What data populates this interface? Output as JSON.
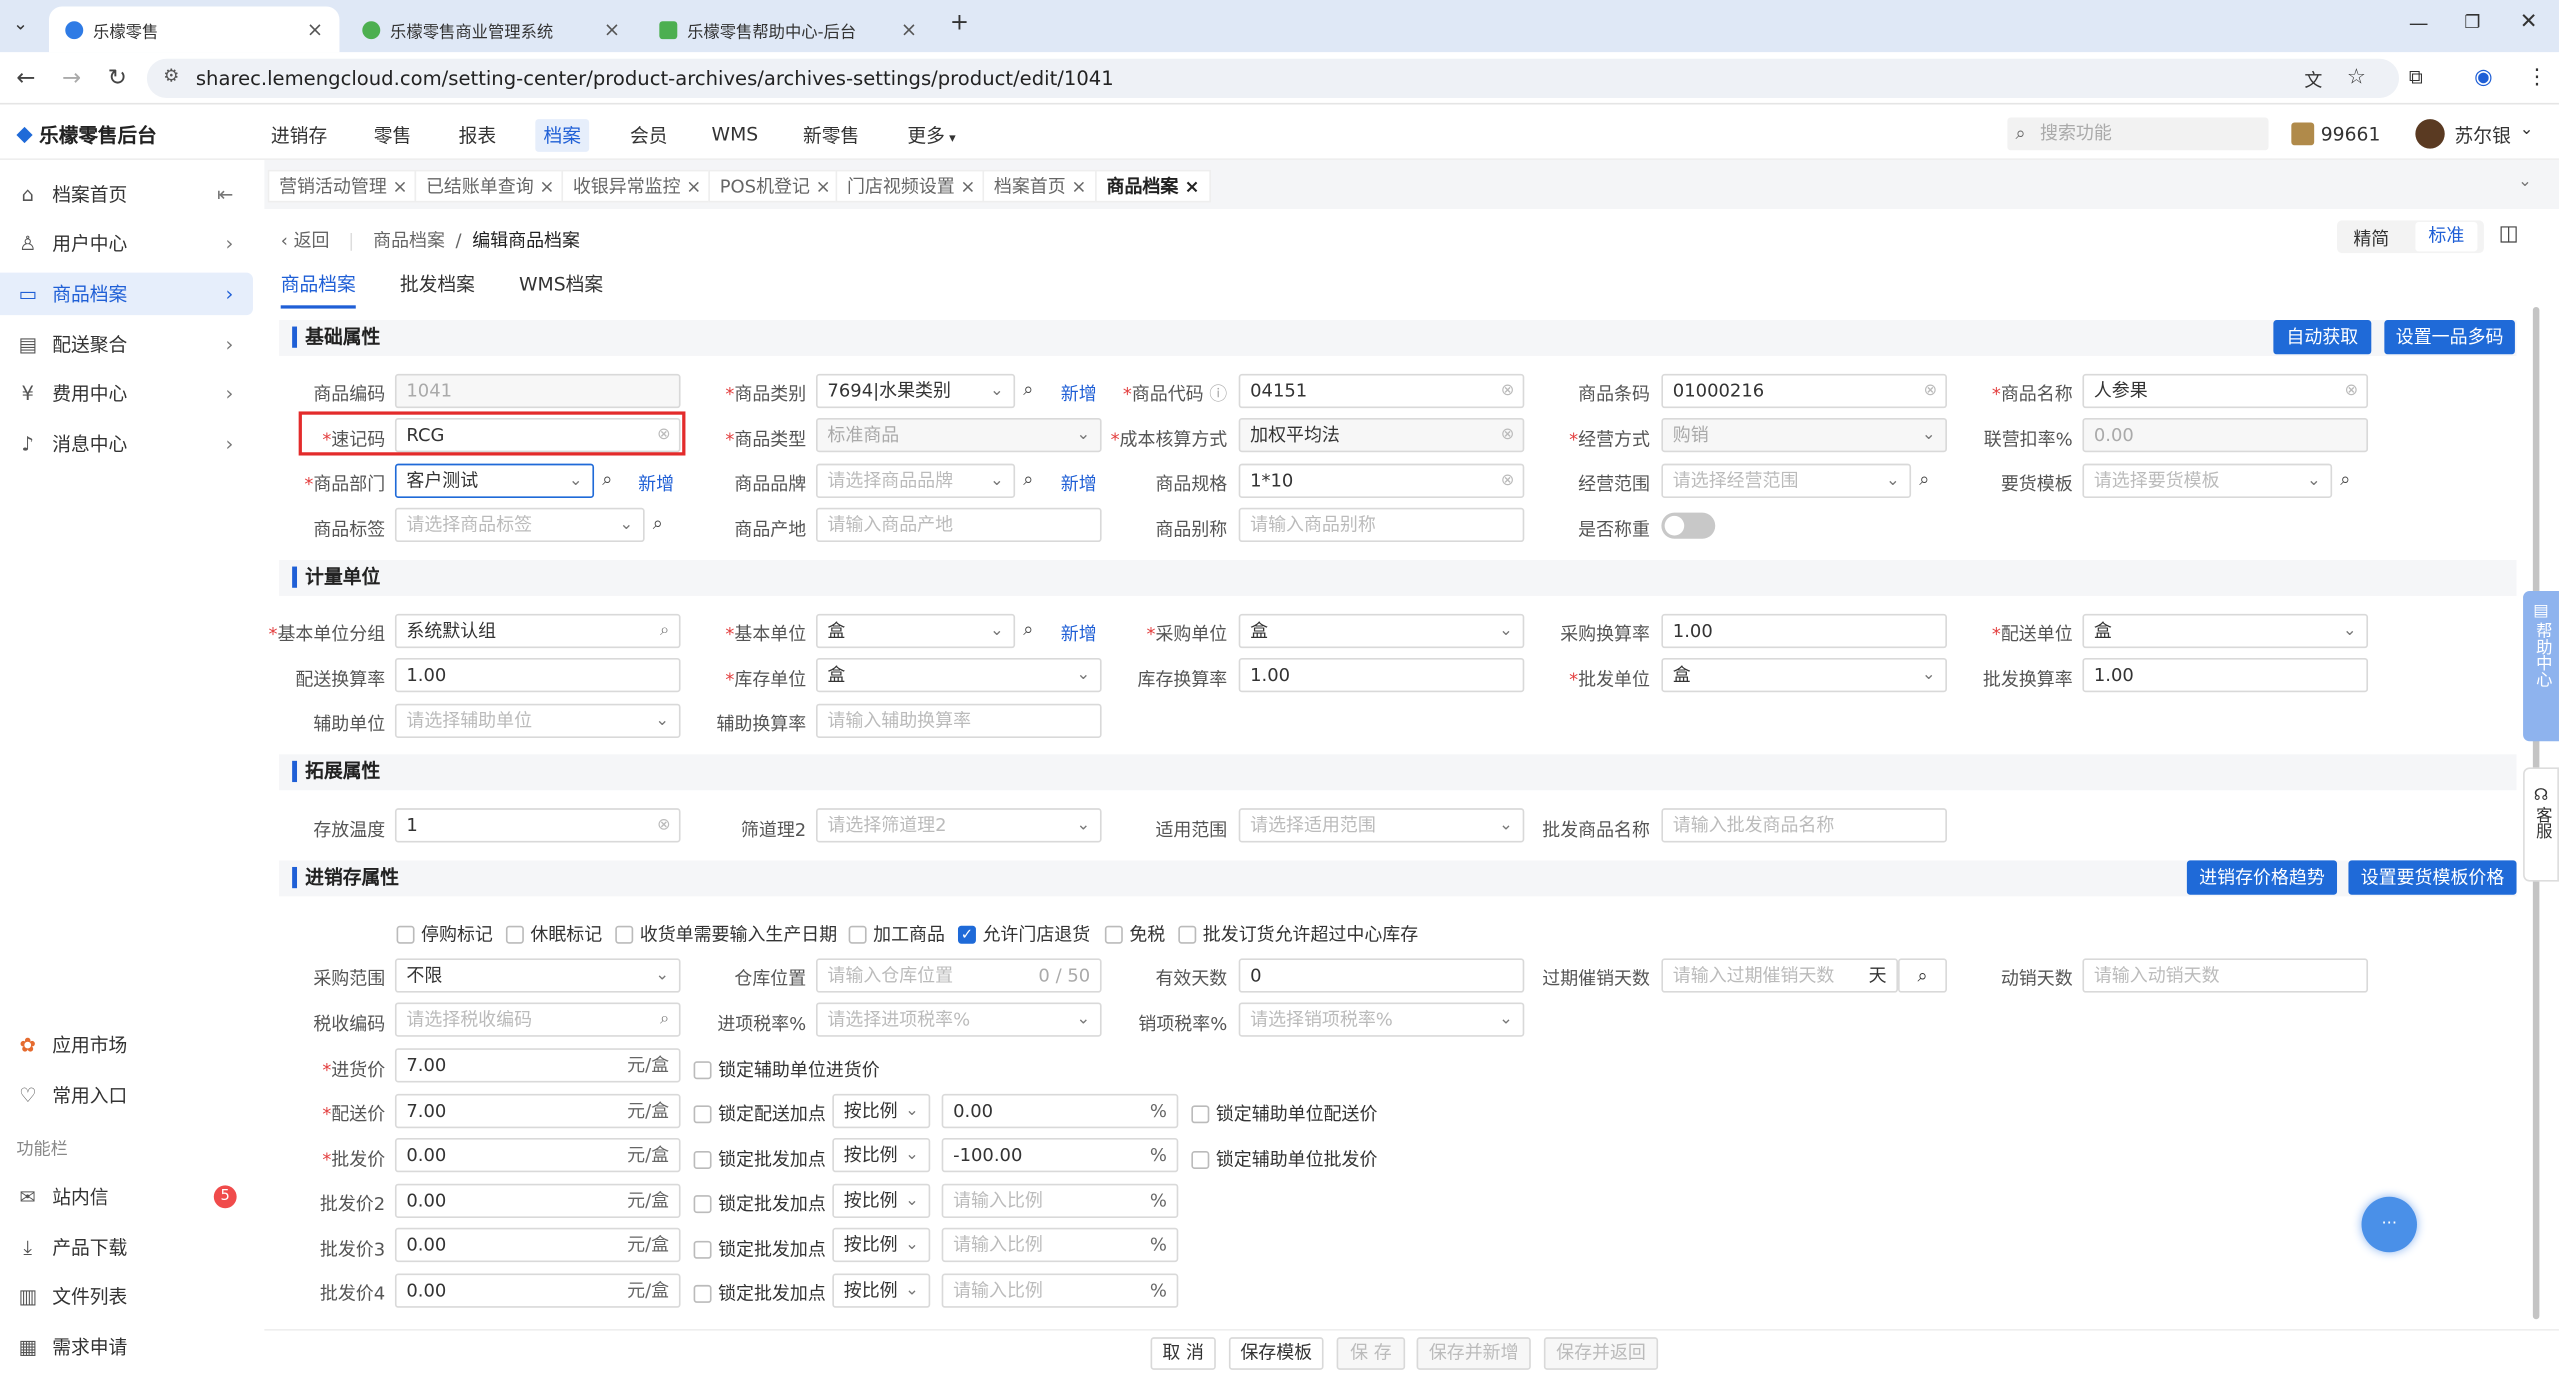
{
  "browser": {
    "tabs": [
      {
        "title": "乐檬零售",
        "active": true
      },
      {
        "title": "乐檬零售商业管理系统",
        "active": false
      },
      {
        "title": "乐檬零售帮助中心-后台",
        "active": false
      }
    ],
    "url": "sharec.lemengcloud.com/setting-center/product-archives/archives-settings/product/edit/1041"
  },
  "app": {
    "logo": "乐檬零售后台",
    "nav": [
      "进销存",
      "零售",
      "报表",
      "档案",
      "会员",
      "WMS",
      "新零售",
      "更多"
    ],
    "active_nav": "档案",
    "search_placeholder": "搜索功能",
    "points": "99661",
    "user": "苏尔银"
  },
  "sidebar": {
    "items": [
      {
        "label": "档案首页",
        "icon": "home-icon"
      },
      {
        "label": "用户中心",
        "icon": "user-icon"
      },
      {
        "label": "商品档案",
        "icon": "box-icon"
      },
      {
        "label": "配送聚合",
        "icon": "truck-icon"
      },
      {
        "label": "费用中心",
        "icon": "yen-icon"
      },
      {
        "label": "消息中心",
        "icon": "bell-icon"
      }
    ],
    "bottom": [
      {
        "label": "应用市场"
      },
      {
        "label": "常用入口"
      }
    ],
    "func_title": "功能栏",
    "func_items": [
      {
        "label": "站内信",
        "badge": "5"
      },
      {
        "label": "产品下载"
      },
      {
        "label": "文件列表"
      },
      {
        "label": "需求申请"
      }
    ]
  },
  "page_tabs": [
    "营销活动管理",
    "已结账单查询",
    "收银异常监控",
    "POS机登记",
    "门店视频设置",
    "档案首页",
    "商品档案"
  ],
  "breadcrumb": {
    "back": "返回",
    "parent": "商品档案",
    "current": "编辑商品档案"
  },
  "sub_tabs": [
    "商品档案",
    "批发档案",
    "WMS档案"
  ],
  "view_toggle": [
    "精简",
    "标准"
  ],
  "sections": {
    "basic": "基础属性",
    "unit": "计量单位",
    "ext": "拓展属性",
    "inv": "进销存属性"
  },
  "buttons": {
    "auto_get": "自动获取",
    "multi_code": "设置一品多码",
    "price_trend": "进销存价格趋势",
    "template_price": "设置要货模板价格",
    "add": "新增"
  },
  "basic": {
    "code_label": "商品编码",
    "code": "1041",
    "category_label": "商品类别",
    "category": "7694|水果类别",
    "pcode_label": "商品代码",
    "pcode": "04151",
    "barcode_label": "商品条码",
    "barcode": "01000216",
    "name_label": "商品名称",
    "name": "人参果",
    "shortcode_label": "速记码",
    "shortcode": "RCG",
    "type_label": "商品类型",
    "type": "标准商品",
    "cost_label": "成本核算方式",
    "cost": "加权平均法",
    "biz_label": "经营方式",
    "biz": "购销",
    "rate_label": "联营扣率%",
    "rate": "0.00",
    "dept_label": "商品部门",
    "dept": "客户测试",
    "brand_label": "商品品牌",
    "brand_ph": "请选择商品品牌",
    "spec_label": "商品规格",
    "spec": "1*10",
    "scope_label": "经营范围",
    "scope_ph": "请选择经营范围",
    "tpl_label": "要货模板",
    "tpl_ph": "请选择要货模板",
    "tag_label": "商品标签",
    "tag_ph": "请选择商品标签",
    "origin_label": "商品产地",
    "origin_ph": "请输入商品产地",
    "alias_label": "商品别称",
    "alias_ph": "请输入商品别称",
    "weigh_label": "是否称重"
  },
  "unit": {
    "group_label": "基本单位分组",
    "group": "系统默认组",
    "base_label": "基本单位",
    "base": "盒",
    "buy_label": "采购单位",
    "buy": "盒",
    "buy_rate_label": "采购换算率",
    "buy_rate": "1.00",
    "dist_label": "配送单位",
    "dist": "盒",
    "dist_rate_label": "配送换算率",
    "dist_rate": "1.00",
    "stock_label": "库存单位",
    "stock": "盒",
    "stock_rate_label": "库存换算率",
    "stock_rate": "1.00",
    "whole_label": "批发单位",
    "whole": "盒",
    "whole_rate_label": "批发换算率",
    "whole_rate": "1.00",
    "aux_label": "辅助单位",
    "aux_ph": "请选择辅助单位",
    "aux_rate_label": "辅助换算率",
    "aux_rate_ph": "请输入辅助换算率"
  },
  "ext": {
    "temp_label": "存放温度",
    "temp": "1",
    "filter_label": "筛道理2",
    "filter_ph": "请选择筛道理2",
    "apply_label": "适用范围",
    "apply_ph": "请选择适用范围",
    "wname_label": "批发商品名称",
    "wname_ph": "请输入批发商品名称"
  },
  "inv": {
    "checks": [
      {
        "label": "停购标记",
        "on": false
      },
      {
        "label": "休眠标记",
        "on": false
      },
      {
        "label": "收货单需要输入生产日期",
        "on": false
      },
      {
        "label": "加工商品",
        "on": false
      },
      {
        "label": "允许门店退货",
        "on": true
      },
      {
        "label": "免税",
        "on": false
      },
      {
        "label": "批发订货允许超过中心库存",
        "on": false
      }
    ],
    "buy_scope_label": "采购范围",
    "buy_scope": "不限",
    "loc_label": "仓库位置",
    "loc_ph": "请输入仓库位置",
    "loc_count": "0 / 50",
    "valid_label": "有效天数",
    "valid": "0",
    "expire_label": "过期催销天数",
    "expire_ph": "请输入过期催销天数",
    "expire_unit": "天",
    "move_label": "动销天数",
    "move_ph": "请输入动销天数",
    "tax_label": "税收编码",
    "tax_ph": "请选择税收编码",
    "in_tax_label": "进项税率%",
    "in_tax_ph": "请选择进项税率%",
    "out_tax_label": "销项税率%",
    "out_tax_ph": "请选择销项税率%",
    "unit_suffix": "元/盒",
    "pct": "%",
    "ratio": "按比例",
    "ratio_ph": "请输入比例",
    "prices": [
      {
        "label": "进货价",
        "value": "7.00",
        "req": true,
        "lock": "锁定辅助单位进货价"
      },
      {
        "label": "配送价",
        "value": "7.00",
        "req": true,
        "lock": "锁定配送加点",
        "ratio_val": "0.00",
        "lock2": "锁定辅助单位配送价"
      },
      {
        "label": "批发价",
        "value": "0.00",
        "req": true,
        "lock": "锁定批发加点",
        "ratio_val": "-100.00",
        "lock2": "锁定辅助单位批发价"
      },
      {
        "label": "批发价2",
        "value": "0.00",
        "req": false,
        "lock": "锁定批发加点"
      },
      {
        "label": "批发价3",
        "value": "0.00",
        "req": false,
        "lock": "锁定批发加点"
      },
      {
        "label": "批发价4",
        "value": "0.00",
        "req": false,
        "lock": "锁定批发加点"
      }
    ]
  },
  "footer": [
    "取 消",
    "保存模板",
    "保 存",
    "保存并新增",
    "保存并返回"
  ],
  "float": {
    "help": "帮助中心",
    "service": "客服"
  },
  "colors": {
    "accent": "#1f6ad8",
    "danger": "#e32b2b"
  }
}
